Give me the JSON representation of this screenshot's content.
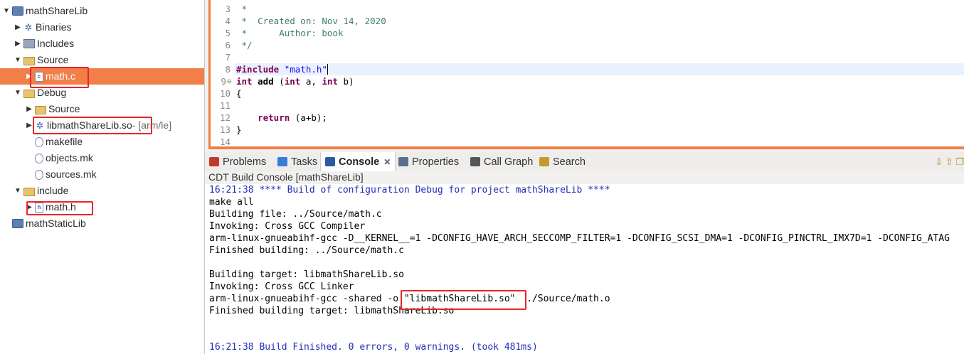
{
  "explorer": {
    "items": [
      {
        "label": "mathShareLib",
        "arrow": "▼",
        "icon": "project-icon"
      },
      {
        "label": "Binaries",
        "arrow": "▶",
        "icon": "binaries-icon"
      },
      {
        "label": "Includes",
        "arrow": "▶",
        "icon": "includes-icon"
      },
      {
        "label": "Source",
        "arrow": "▼",
        "icon": "folder-icon"
      },
      {
        "label": "math.c",
        "arrow": "▶",
        "icon": "c-file-icon"
      },
      {
        "label": "Debug",
        "arrow": "▼",
        "icon": "folder-icon"
      },
      {
        "label": "Source",
        "arrow": "▶",
        "icon": "folder-icon"
      },
      {
        "label": "libmathShareLib.so",
        "suffix": " - [arm/le]",
        "arrow": "▶",
        "icon": "shared-lib-icon"
      },
      {
        "label": "makefile",
        "arrow": "",
        "icon": "makefile-icon"
      },
      {
        "label": "objects.mk",
        "arrow": "",
        "icon": "makefile-icon"
      },
      {
        "label": "sources.mk",
        "arrow": "",
        "icon": "makefile-icon"
      },
      {
        "label": "include",
        "arrow": "▼",
        "icon": "folder-icon"
      },
      {
        "label": "math.h",
        "arrow": "▶",
        "icon": "h-file-icon"
      },
      {
        "label": "mathStaticLib",
        "arrow": "",
        "icon": "project-icon"
      }
    ]
  },
  "editor": {
    "lines": [
      {
        "n": "3",
        "text": " *"
      },
      {
        "n": "4",
        "text": " *  Created on: Nov 14, 2020"
      },
      {
        "n": "5",
        "text": " *      Author: book"
      },
      {
        "n": "6",
        "text": " */"
      },
      {
        "n": "7",
        "text": ""
      },
      {
        "n": "8",
        "text": "#include \"math.h\""
      },
      {
        "n": "9",
        "text": "int add (int a, int b)"
      },
      {
        "n": "10",
        "text": "{"
      },
      {
        "n": "11",
        "text": ""
      },
      {
        "n": "12",
        "text": "    return (a+b);"
      },
      {
        "n": "13",
        "text": "}"
      },
      {
        "n": "14",
        "text": ""
      }
    ],
    "fold_marker": "⊖"
  },
  "tabs": [
    {
      "label": "Problems",
      "color": "#c0392b"
    },
    {
      "label": "Tasks",
      "color": "#3a7bd5"
    },
    {
      "label": "Console",
      "color": "#2c5aa0",
      "active": true,
      "close": "✕"
    },
    {
      "label": "Properties",
      "color": "#5a6f8a"
    },
    {
      "label": "Call Graph",
      "color": "#555555"
    },
    {
      "label": "Search",
      "color": "#c49a2a"
    }
  ],
  "console": {
    "title": "CDT Build Console [mathShareLib]",
    "lines": [
      {
        "text": "16:21:38 **** Build of configuration Debug for project mathShareLib ****",
        "blue": true
      },
      {
        "text": "make all"
      },
      {
        "text": "Building file: ../Source/math.c"
      },
      {
        "text": "Invoking: Cross GCC Compiler"
      },
      {
        "text": "arm-linux-gnueabihf-gcc -D__KERNEL__=1 -DCONFIG_HAVE_ARCH_SECCOMP_FILTER=1 -DCONFIG_SCSI_DMA=1 -DCONFIG_PINCTRL_IMX7D=1 -DCONFIG_ATAG"
      },
      {
        "text": "Finished building: ../Source/math.c"
      },
      {
        "text": ""
      },
      {
        "text": "Building target: libmathShareLib.so"
      },
      {
        "text": "Invoking: Cross GCC Linker"
      },
      {
        "text": "arm-linux-gnueabihf-gcc -shared -o \"libmathShareLib.so\"  ./Source/math.o"
      },
      {
        "text": "Finished building target: libmathShareLib.so"
      },
      {
        "text": ""
      },
      {
        "text": ""
      },
      {
        "text": "16:21:38 Build Finished. 0 errors, 0 warnings. (took 481ms)",
        "blue": true
      }
    ]
  },
  "colors": {
    "selection": "#f07f48",
    "highlight_box": "#e8262b",
    "console_blue": "#1f2fb8"
  }
}
